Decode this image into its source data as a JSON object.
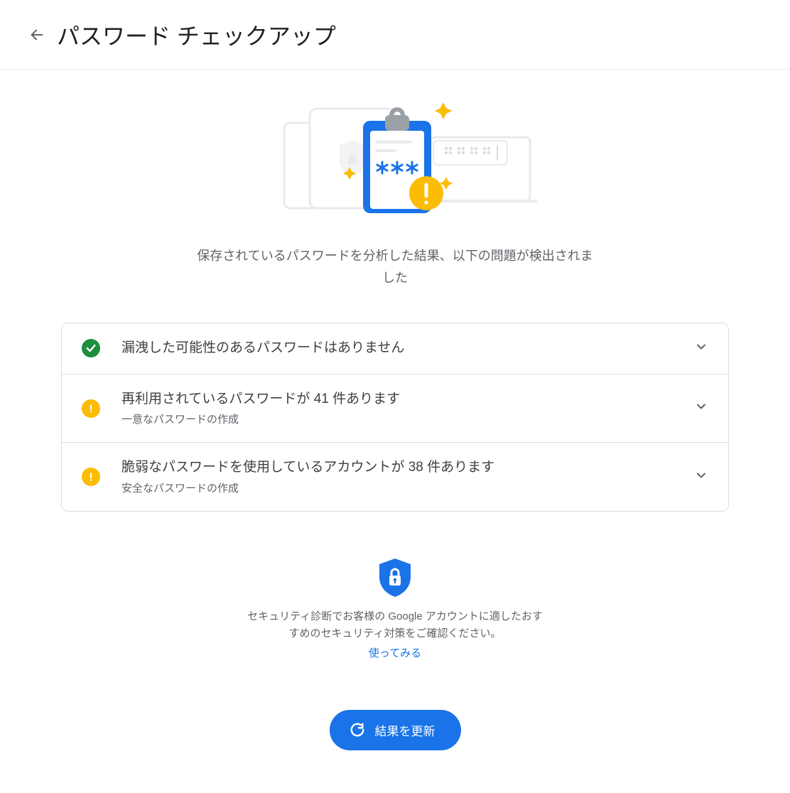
{
  "header": {
    "title": "パスワード チェックアップ"
  },
  "hero": {
    "caption": "保存されているパスワードを分析した結果、以下の問題が検出されました"
  },
  "issues": [
    {
      "status": "ok",
      "title": "漏洩した可能性のあるパスワードはありません",
      "subtitle": ""
    },
    {
      "status": "warn",
      "title": "再利用されているパスワードが 41 件あります",
      "subtitle": "一意なパスワードの作成"
    },
    {
      "status": "warn",
      "title": "脆弱なパスワードを使用しているアカウントが 38 件あります",
      "subtitle": "安全なパスワードの作成"
    }
  ],
  "security": {
    "text": "セキュリティ診断でお客様の Google アカウントに適したおすすめのセキュリティ対策をご確認ください。",
    "link": "使ってみる"
  },
  "refresh": {
    "label": "結果を更新"
  },
  "colors": {
    "primary": "#1a73e8",
    "ok": "#1e8e3e",
    "warn": "#fbbc04",
    "text_secondary": "#5f6368",
    "border": "#dadce0"
  }
}
